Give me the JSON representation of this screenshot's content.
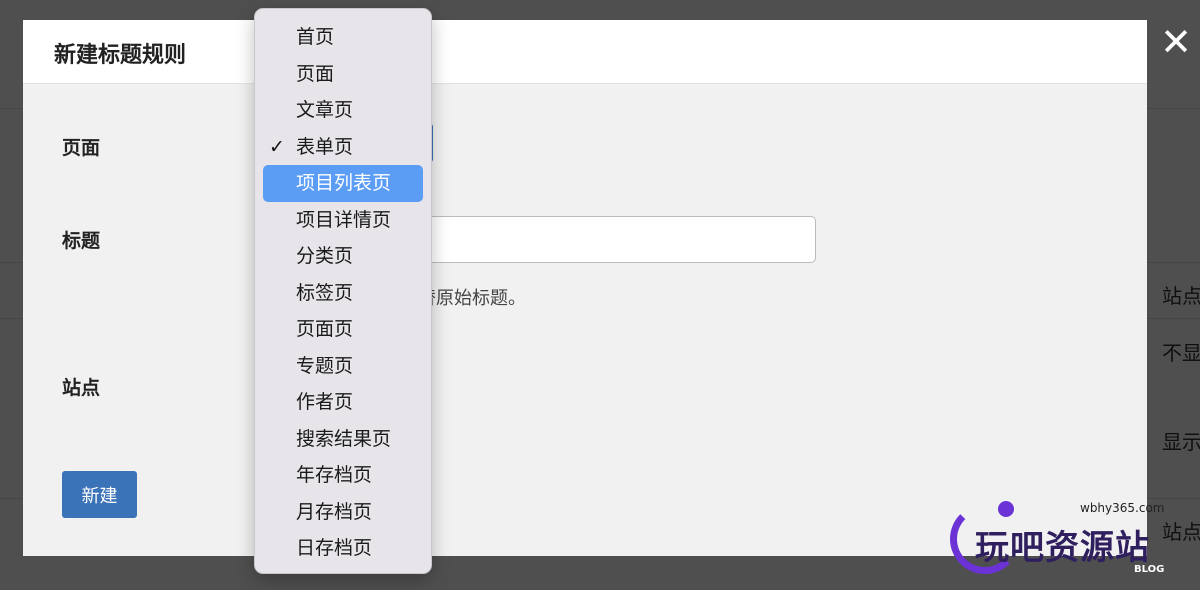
{
  "background_page": {
    "column_header": "站点",
    "rows": [
      "不显",
      "显示"
    ],
    "footer_header": "站点"
  },
  "close_label": "✕",
  "modal": {
    "title": "新建标题规则",
    "page_label": "页面",
    "title_label": "标题",
    "site_label": "站点",
    "title_input_value": "",
    "title_hint": "替原始标题。",
    "create_button": "新建"
  },
  "dropdown": {
    "checked_item": "表单页",
    "highlighted_item": "项目列表页",
    "items": [
      "首页",
      "页面",
      "文章页",
      "表单页",
      "项目列表页",
      "项目详情页",
      "分类页",
      "标签页",
      "页面页",
      "专题页",
      "作者页",
      "搜索结果页",
      "年存档页",
      "月存档页",
      "日存档页"
    ]
  },
  "watermark": {
    "url": "wbhy365.com",
    "name": "玩吧资源站",
    "blog": "BLOG"
  },
  "colors": {
    "accent": "#3b73b8",
    "highlight": "#5b9cf4",
    "watermark": "#6b33d6"
  }
}
